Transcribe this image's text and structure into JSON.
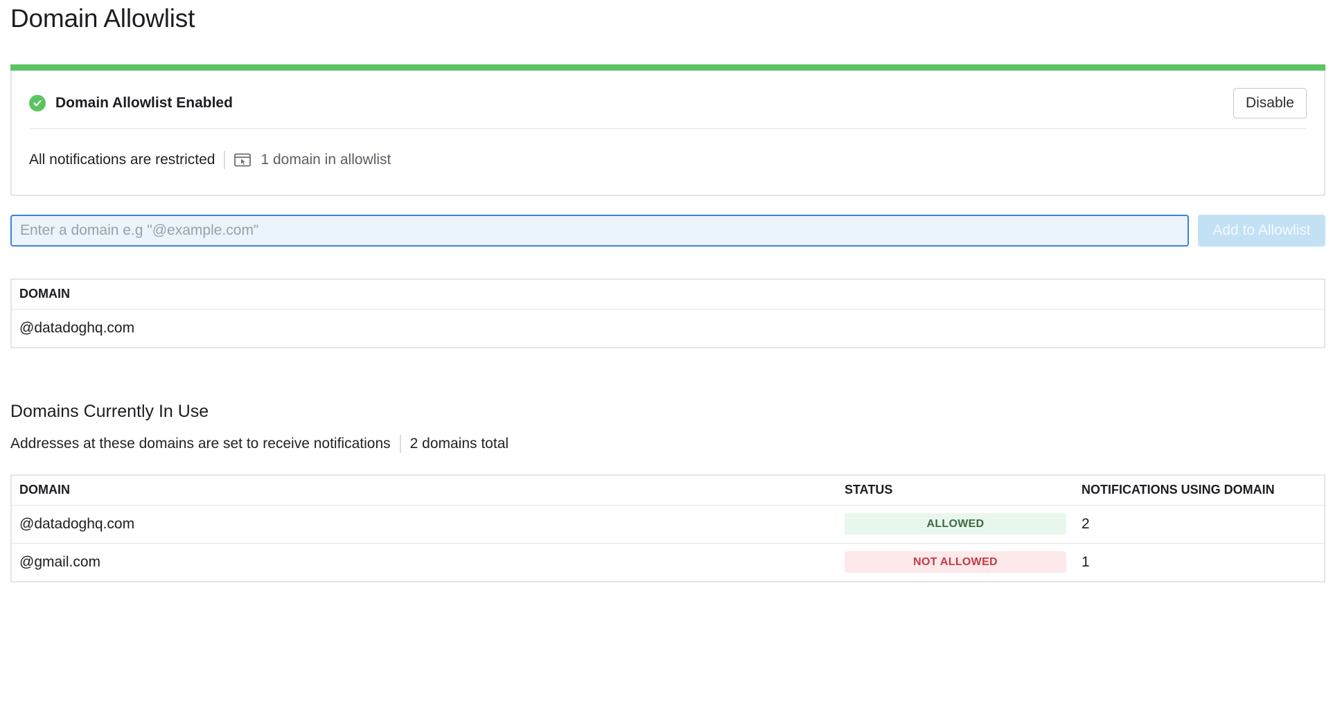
{
  "page": {
    "title": "Domain Allowlist"
  },
  "status_card": {
    "title": "Domain Allowlist Enabled",
    "disable_label": "Disable",
    "restriction_text": "All notifications are restricted",
    "domain_count_text": "1 domain in allowlist",
    "accent_color": "#5bc462"
  },
  "add_form": {
    "input_value": "",
    "input_placeholder": "Enter a domain e.g \"@example.com\"",
    "add_label": "Add to Allowlist"
  },
  "allowlist_table": {
    "columns": [
      "DOMAIN"
    ],
    "rows": [
      {
        "domain": "@datadoghq.com"
      }
    ]
  },
  "in_use": {
    "title": "Domains Currently In Use",
    "description": "Addresses at these domains are set to receive notifications",
    "total_text": "2 domains total",
    "columns": [
      "DOMAIN",
      "STATUS",
      "NOTIFICATIONS USING DOMAIN"
    ],
    "rows": [
      {
        "domain": "@datadoghq.com",
        "status": "ALLOWED",
        "status_kind": "allowed",
        "count": "2"
      },
      {
        "domain": "@gmail.com",
        "status": "NOT ALLOWED",
        "status_kind": "not-allowed",
        "count": "1"
      }
    ]
  },
  "icons": {
    "status": "check-circle-icon",
    "allowlist_count": "browser-window-cursor-icon"
  }
}
